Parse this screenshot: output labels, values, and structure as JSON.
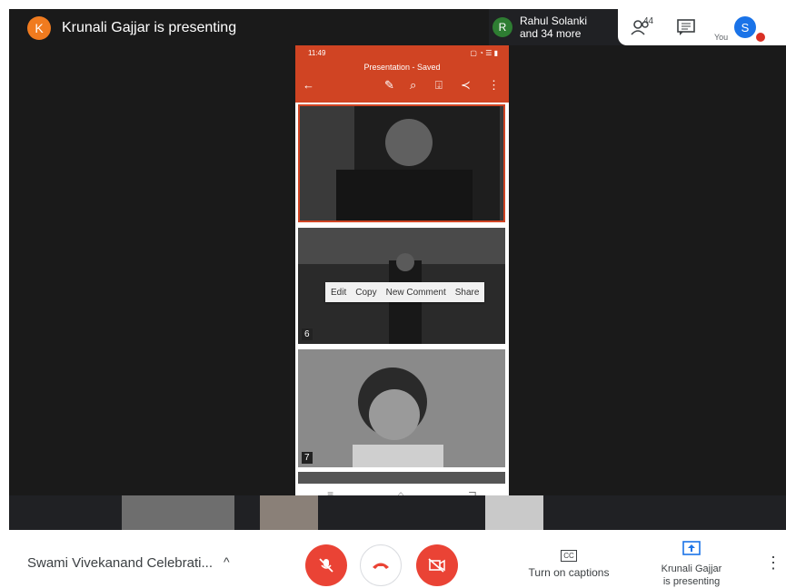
{
  "presenter": {
    "avatar_letter": "K",
    "text": "Krunali Gajjar is presenting"
  },
  "participants": {
    "avatar_letter": "R",
    "line1": "Rahul Solanki",
    "line2": "and 34 more",
    "count": "44"
  },
  "self": {
    "label": "You",
    "avatar_letter": "S"
  },
  "phone": {
    "status_time": "11:49",
    "status_right": "▢ ◔ ☰ ▮",
    "doc_title": "Presentation - Saved",
    "context_menu": [
      "Edit",
      "Copy",
      "New Comment",
      "Share"
    ],
    "slides": [
      {
        "num": ""
      },
      {
        "num": "6"
      },
      {
        "num": "7"
      }
    ]
  },
  "bottom": {
    "meeting_title": "Swami Vivekanand Celebrati...",
    "captions_label": "Turn on captions",
    "captions_icon": "CC",
    "present_line1": "Krunali Gajjar",
    "present_line2": "is presenting"
  },
  "colors": {
    "accent_red": "#ea4335",
    "toolbar_orange": "#d04423",
    "stage_bg": "#1a1a1a"
  }
}
